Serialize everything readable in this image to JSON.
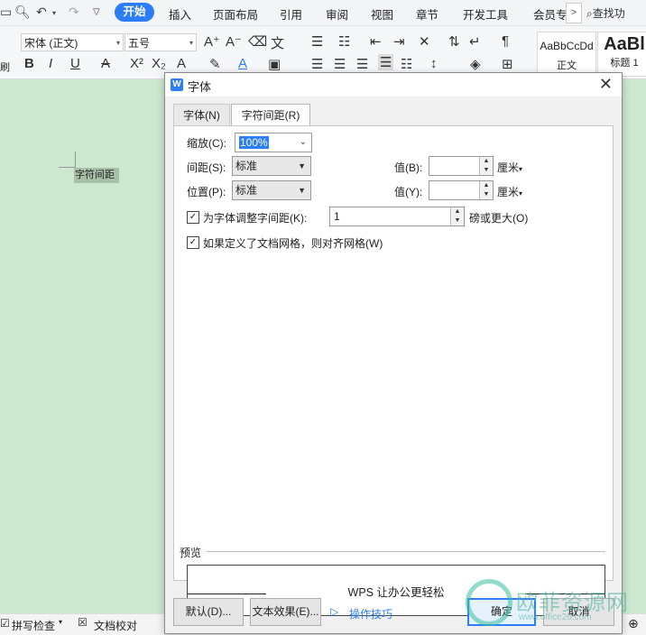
{
  "menubar": {
    "tabs": [
      "开始",
      "插入",
      "页面布局",
      "引用",
      "审阅",
      "视图",
      "章节",
      "开发工具",
      "会员专"
    ],
    "find_label": "查找功"
  },
  "ribbon": {
    "font_name": "宋体 (正文)",
    "font_size": "五号",
    "style1_sample": "AaBbCcDd",
    "style1_name": "正文",
    "style2_sample": "AaBl",
    "style2_name": "标题 1",
    "left_edge_label": "刷"
  },
  "document": {
    "selected_text": "字符间距"
  },
  "statusbar": {
    "spellcheck": "拼写检查",
    "doc_check": "文档校对"
  },
  "dialog": {
    "title": "字体",
    "tabs": [
      "字体(N)",
      "字符间距(R)"
    ],
    "active_tab": "字符间距(R)",
    "scale_label": "缩放(C):",
    "scale_value": "100%",
    "spacing_label": "间距(S):",
    "spacing_value": "标准",
    "spacing_by_label": "值(B):",
    "spacing_by_value": "",
    "spacing_unit": "厘米",
    "position_label": "位置(P):",
    "position_value": "标准",
    "position_by_label": "值(Y):",
    "position_by_value": "",
    "position_unit": "厘米",
    "kerning_label": "为字体调整字间距(K):",
    "kerning_checked": true,
    "kerning_value": "1",
    "kerning_suffix": "磅或更大(O)",
    "grid_label": "如果定义了文档网格，则对齐网格(W)",
    "grid_checked": true,
    "preview_label": "预览",
    "preview_text": "WPS 让办公更轻松",
    "buttons": {
      "default": "默认(D)...",
      "text_effects": "文本效果(E)...",
      "tips": "操作技巧",
      "ok": "确定",
      "cancel": "取消"
    }
  },
  "watermark": {
    "text": "欧菲资源网",
    "url": "www.office26.com"
  },
  "colors": {
    "accent": "#2d7df6",
    "doc_background": "#cce8cf"
  }
}
